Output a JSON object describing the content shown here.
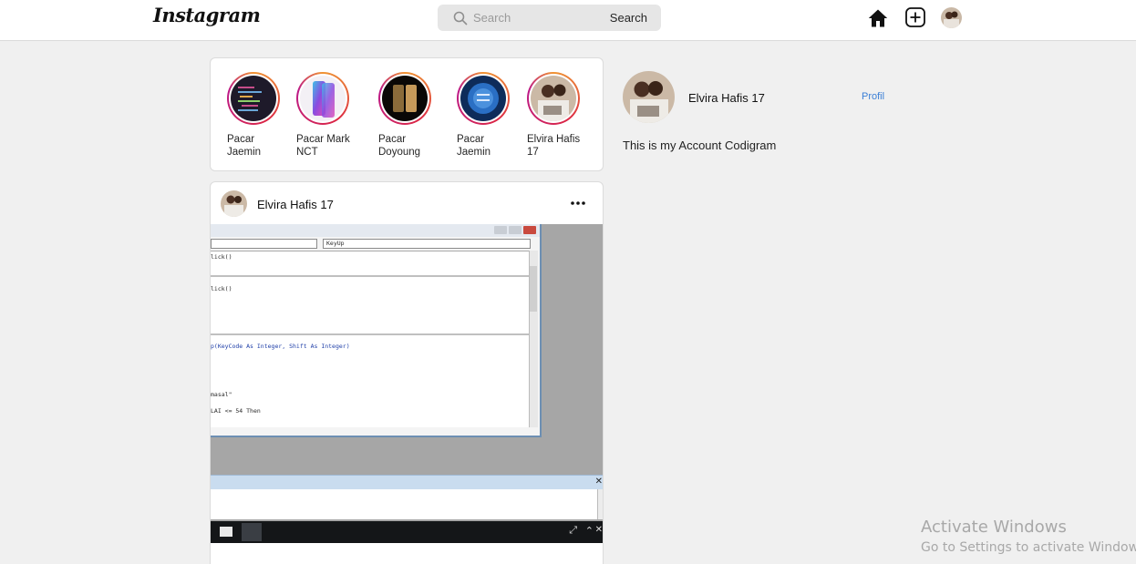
{
  "header": {
    "logo": "Instagram",
    "search_placeholder": "Search",
    "search_button": "Search",
    "icons": [
      "home-icon",
      "add-post-icon",
      "profile-avatar"
    ]
  },
  "stories": [
    {
      "label": "Pacar Jaemin"
    },
    {
      "label": "Pacar Mark NCT"
    },
    {
      "label": "Pacar Doyoung"
    },
    {
      "label": "Pacar Jaemin"
    },
    {
      "label": "Elvira Hafis 17"
    }
  ],
  "post": {
    "username": "Elvira Hafis 17",
    "more_icon": "more-options-icon",
    "code_lines": {
      "combo_right": "KeyUp",
      "line1": "lick()",
      "line2": "lick()",
      "line3": "p(KeyCode As Integer, Shift As Integer)",
      "line4": "masal\"",
      "line5": "LAI <= 54 Then"
    }
  },
  "sidebar": {
    "username": "Elvira Hafis 17",
    "profile_link": "Profil",
    "bio": "This is my Account Codigram"
  },
  "watermark": {
    "title": "Activate Windows",
    "subtitle": "Go to Settings to activate Windows."
  },
  "colors": {
    "link": "#3b7fd6",
    "background": "#f0f0f0",
    "story_ring": "#dc2743"
  }
}
